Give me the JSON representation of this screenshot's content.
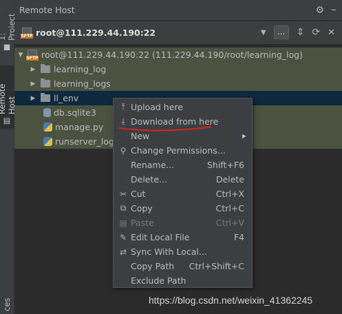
{
  "sidebar": {
    "tabs": [
      {
        "label": "1: Project",
        "icon": "folder-icon",
        "active": false
      },
      {
        "label": "Remote Host",
        "icon": "remote-host-icon",
        "active": true
      },
      {
        "label": "ces"
      }
    ]
  },
  "panel": {
    "title": "Remote Host",
    "title_icons": [
      "gear-icon",
      "minimize-icon"
    ]
  },
  "toolbar": {
    "badge": "SFTP",
    "host": "root@111.229.44.190:22",
    "browse_label": "...",
    "icons": [
      "dropdown-arrow-icon",
      "collapse-icon",
      "refresh-icon",
      "close-icon"
    ]
  },
  "tree": {
    "root": {
      "badge": "SFTP",
      "label": "root@111.229.44.190:22 (111.229.44.190/root/learning_log)"
    },
    "items": [
      {
        "label": "learning_log",
        "type": "folder"
      },
      {
        "label": "learning_logs",
        "type": "folder"
      },
      {
        "label": "ll_env",
        "type": "folder"
      },
      {
        "label": "db.sqlite3",
        "type": "db-file"
      },
      {
        "label": "manage.py",
        "type": "python-file"
      },
      {
        "label": "runserver_log",
        "type": "file"
      }
    ]
  },
  "context_menu": {
    "items": [
      {
        "label": "Upload here",
        "shortcut": "",
        "icon": "upload-icon",
        "disabled": false
      },
      {
        "label": "Download from here",
        "shortcut": "",
        "icon": "download-icon",
        "disabled": false
      },
      {
        "label": "New",
        "shortcut": "",
        "icon": "",
        "submenu": true,
        "disabled": false
      },
      {
        "label": "Change Permissions...",
        "shortcut": "",
        "icon": "key-icon",
        "disabled": false
      },
      {
        "label": "Rename...",
        "shortcut": "Shift+F6",
        "icon": "",
        "disabled": false
      },
      {
        "label": "Delete...",
        "shortcut": "Delete",
        "icon": "",
        "disabled": false
      },
      {
        "label": "Cut",
        "shortcut": "Ctrl+X",
        "icon": "scissors-icon",
        "disabled": false
      },
      {
        "label": "Copy",
        "shortcut": "Ctrl+C",
        "icon": "copy-icon",
        "disabled": false
      },
      {
        "label": "Paste",
        "shortcut": "Ctrl+V",
        "icon": "paste-icon",
        "disabled": true
      },
      {
        "label": "Edit Local File",
        "shortcut": "F4",
        "icon": "edit-icon",
        "disabled": false
      },
      {
        "label": "Sync With Local...",
        "shortcut": "",
        "icon": "sync-icon",
        "disabled": false
      },
      {
        "label": "Copy Path",
        "shortcut": "Ctrl+Shift+C",
        "icon": "",
        "disabled": false
      },
      {
        "label": "Exclude Path",
        "shortcut": "",
        "icon": "",
        "disabled": false
      }
    ]
  },
  "watermark": "https://blog.csdn.net/weixin_41362245",
  "colors": {
    "highlight_row": "#4b5340",
    "selected_row": "#0d293e",
    "annotation": "#e0201c"
  }
}
